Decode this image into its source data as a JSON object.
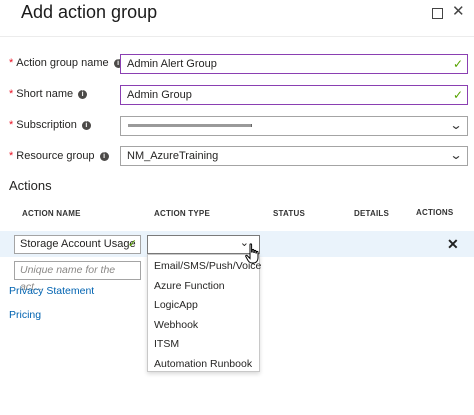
{
  "window": {
    "title": "Add action group",
    "maximize_icon": "maximize-icon",
    "close_icon": "close-icon"
  },
  "form": {
    "action_group_name": {
      "label": "Action group name",
      "value": "Admin Alert Group"
    },
    "short_name": {
      "label": "Short name",
      "value": "Admin Group"
    },
    "subscription": {
      "label": "Subscription",
      "value": ""
    },
    "resource_group": {
      "label": "Resource group",
      "value": "NM_AzureTraining"
    },
    "required_mark": "*",
    "info_glyph": "i"
  },
  "actions": {
    "section_title": "Actions",
    "columns": [
      "ACTION NAME",
      "ACTION TYPE",
      "STATUS",
      "DETAILS",
      "ACTIONS"
    ],
    "row": {
      "name": "Storage Account Usage",
      "type": ""
    },
    "new_row_placeholder": "Unique name for the act..."
  },
  "links": {
    "privacy": "Privacy Statement",
    "pricing": "Pricing"
  },
  "dropdown": {
    "options": [
      "Email/SMS/Push/Voice",
      "Azure Function",
      "LogicApp",
      "Webhook",
      "ITSM",
      "Automation Runbook"
    ]
  },
  "colors": {
    "accent_border": "#8a3fb2",
    "valid_check": "#57a300",
    "link": "#0063b1",
    "row_highlight": "#eaf3fb"
  }
}
